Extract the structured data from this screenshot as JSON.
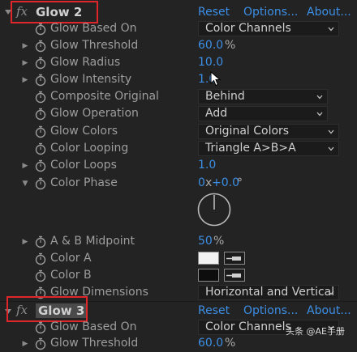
{
  "effect1": {
    "name": "Glow 2",
    "reset": "Reset",
    "options": "Options...",
    "about": "About...",
    "params": {
      "based_on": {
        "label": "Glow Based On",
        "value": "Color Channels"
      },
      "threshold": {
        "label": "Glow Threshold",
        "value": "60.0",
        "unit": "%"
      },
      "radius": {
        "label": "Glow Radius",
        "value": "10.0"
      },
      "intensity": {
        "label": "Glow Intensity",
        "value": "1.0"
      },
      "composite": {
        "label": "Composite Original",
        "value": "Behind"
      },
      "operation": {
        "label": "Glow Operation",
        "value": "Add"
      },
      "colors": {
        "label": "Glow Colors",
        "value": "Original Colors"
      },
      "looping": {
        "label": "Color Looping",
        "value": "Triangle A>B>A"
      },
      "loops": {
        "label": "Color Loops",
        "value": "1.0"
      },
      "phase": {
        "label": "Color Phase",
        "rev": "0",
        "x": "x",
        "deg": "+0.0",
        "unit": "°"
      },
      "midpoint": {
        "label": "A & B Midpoint",
        "value": "50",
        "unit": "%"
      },
      "color_a": {
        "label": "Color A",
        "swatch": "#f2f2f2"
      },
      "color_b": {
        "label": "Color B",
        "swatch": "#0d0d0d"
      },
      "dimensions": {
        "label": "Glow Dimensions",
        "value": "Horizontal and Vertical"
      }
    }
  },
  "effect2": {
    "name": "Glow 3",
    "reset": "Reset",
    "options": "Options...",
    "about": "About...",
    "params": {
      "based_on": {
        "label": "Glow Based On",
        "value": "Color Channels"
      },
      "threshold": {
        "label": "Glow Threshold",
        "value": "60.0",
        "unit": "%"
      }
    }
  },
  "watermark": "头条 @AE手册",
  "colors": {
    "accent": "#3c8fe6",
    "highlight": "#e0262a",
    "bg": "#232323"
  }
}
